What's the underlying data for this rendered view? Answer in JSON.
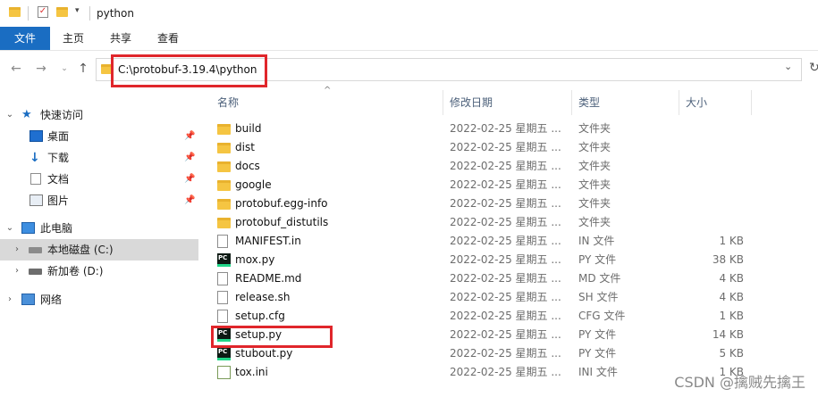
{
  "window": {
    "title": "python"
  },
  "ribbon": {
    "tabs": [
      "文件",
      "主页",
      "共享",
      "查看"
    ]
  },
  "address": {
    "path": "C:\\protobuf-3.19.4\\python"
  },
  "nav": {
    "quick_access": "快速访问",
    "quick_items": [
      "桌面",
      "下载",
      "文档",
      "图片"
    ],
    "this_pc": "此电脑",
    "drives": [
      "本地磁盘 (C:)",
      "新加卷 (D:)"
    ],
    "network": "网络"
  },
  "columns": {
    "name": "名称",
    "date": "修改日期",
    "type": "类型",
    "size": "大小"
  },
  "files": [
    {
      "name": "build",
      "date": "2022-02-25 星期五 ...",
      "type": "文件夹",
      "size": "",
      "kind": "folder"
    },
    {
      "name": "dist",
      "date": "2022-02-25 星期五 ...",
      "type": "文件夹",
      "size": "",
      "kind": "folder"
    },
    {
      "name": "docs",
      "date": "2022-02-25 星期五 ...",
      "type": "文件夹",
      "size": "",
      "kind": "folder"
    },
    {
      "name": "google",
      "date": "2022-02-25 星期五 ...",
      "type": "文件夹",
      "size": "",
      "kind": "folder"
    },
    {
      "name": "protobuf.egg-info",
      "date": "2022-02-25 星期五 ...",
      "type": "文件夹",
      "size": "",
      "kind": "folder"
    },
    {
      "name": "protobuf_distutils",
      "date": "2022-02-25 星期五 ...",
      "type": "文件夹",
      "size": "",
      "kind": "folder"
    },
    {
      "name": "MANIFEST.in",
      "date": "2022-02-25 星期五 ...",
      "type": "IN 文件",
      "size": "1 KB",
      "kind": "doc"
    },
    {
      "name": "mox.py",
      "date": "2022-02-25 星期五 ...",
      "type": "PY 文件",
      "size": "38 KB",
      "kind": "py"
    },
    {
      "name": "README.md",
      "date": "2022-02-25 星期五 ...",
      "type": "MD 文件",
      "size": "4 KB",
      "kind": "doc"
    },
    {
      "name": "release.sh",
      "date": "2022-02-25 星期五 ...",
      "type": "SH 文件",
      "size": "4 KB",
      "kind": "doc"
    },
    {
      "name": "setup.cfg",
      "date": "2022-02-25 星期五 ...",
      "type": "CFG 文件",
      "size": "1 KB",
      "kind": "doc"
    },
    {
      "name": "setup.py",
      "date": "2022-02-25 星期五 ...",
      "type": "PY 文件",
      "size": "14 KB",
      "kind": "py"
    },
    {
      "name": "stubout.py",
      "date": "2022-02-25 星期五 ...",
      "type": "PY 文件",
      "size": "5 KB",
      "kind": "py"
    },
    {
      "name": "tox.ini",
      "date": "2022-02-25 星期五 ...",
      "type": "INI 文件",
      "size": "1 KB",
      "kind": "ini"
    }
  ],
  "watermark": "CSDN @擒贼先擒王",
  "colors": {
    "accent": "#1a6dc2",
    "highlight": "#e0262b",
    "folder": "#f5c542"
  }
}
